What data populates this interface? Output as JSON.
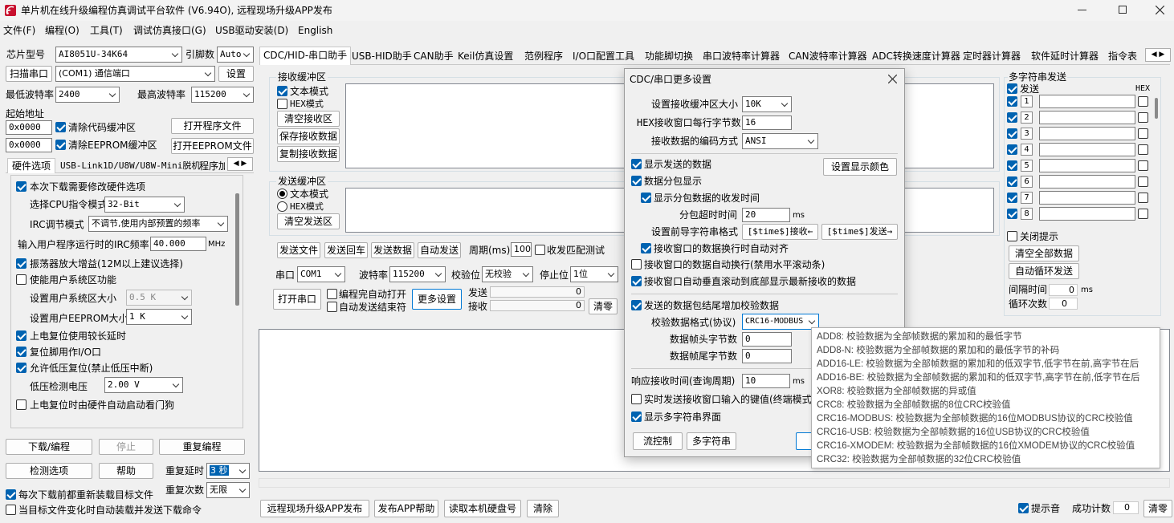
{
  "app": {
    "title": "单片机在线升级编程仿真调试平台软件 (V6.94O), 远程现场升级APP发布",
    "colors": {
      "accent": "#0063b1",
      "title_icon": "#c8102e"
    }
  },
  "menu": [
    "文件(F)",
    "编程(O)",
    "工具(T)",
    "调试仿真接口(G)",
    "USB驱动安装(D)",
    "English"
  ],
  "left": {
    "chip_label": "芯片型号",
    "chip_value": "AI8051U-34K64",
    "pins_label": "引脚数",
    "pins_value": "Auto",
    "scan_btn": "扫描串口",
    "port_value": "(COM1) 通信端口",
    "settings_btn": "设置",
    "min_baud_label": "最低波特率",
    "min_baud_value": "2400",
    "max_baud_label": "最高波特率",
    "max_baud_value": "115200",
    "start_addr_label": "起始地址",
    "addr1": "0x0000",
    "clear_code": "清除代码缓冲区",
    "open_prog": "打开程序文件",
    "addr2": "0x0000",
    "clear_eeprom": "清除EEPROM缓冲区",
    "open_eeprom": "打开EEPROM文件",
    "tabs": [
      "硬件选项",
      "USB-Link1D/U8W/U8W-Mini脱机",
      "程序加"
    ],
    "hw": {
      "need_modify": "本次下载需要修改硬件选项",
      "cpu_mode_label": "选择CPU指令模式",
      "cpu_mode_value": "32-Bit",
      "irc_mode_label": "IRC调节模式",
      "irc_mode_value": "不调节,使用内部预置的频率",
      "irc_freq_label": "输入用户程序运行时的IRC频率",
      "irc_freq_value": "40.000",
      "irc_freq_unit": "MHz",
      "osc_gain": "振荡器放大增益(12M以上建议选择)",
      "user_sys_area": "使能用户系统区功能",
      "sys_area_label": "设置用户系统区大小",
      "sys_area_value": "0.5 K",
      "eeprom_label": "设置用户EEPROM大小",
      "eeprom_value": "1   K",
      "long_delay": "上电复位使用较长延时",
      "reset_io": "复位脚用作I/O口",
      "low_volt_reset": "允许低压复位(禁止低压中断)",
      "low_volt_label": "低压检测电压",
      "low_volt_value": "2.00 V",
      "watchdog": "上电复位时由硬件自动启动看门狗"
    },
    "download_btn": "下载/编程",
    "stop_btn": "停止",
    "reprogram_btn": "重复编程",
    "detect_btn": "检测选项",
    "help_btn": "帮助",
    "repeat_delay_label": "重复延时",
    "repeat_delay_value": "3 秒",
    "repeat_count_label": "重复次数",
    "repeat_count_value": "无限",
    "reload_each": "每次下载前都重新装载目标文件",
    "auto_load": "当目标文件变化时自动装载并发送下载命令"
  },
  "main_tabs": [
    "CDC/HID-串口助手",
    "USB-HID助手",
    "CAN助手",
    "Keil仿真设置",
    "范例程序",
    "I/O口配置工具",
    "功能脚切换",
    "串口波特率计算器",
    "CAN波特率计算器",
    "ADC转换速度计算器",
    "定时器计算器",
    "软件延时计算器",
    "指令表"
  ],
  "serial": {
    "recv_title": "接收缓冲区",
    "text_mode": "文本模式",
    "hex_mode": "HEX模式",
    "clear_recv": "清空接收区",
    "save_recv": "保存接收数据",
    "copy_recv": "复制接收数据",
    "send_title": "发送缓冲区",
    "clear_send": "清空发送区",
    "send_file": "发送文件",
    "send_enter": "发送回车",
    "send_data": "发送数据",
    "auto_send": "自动发送",
    "period_label": "周期(ms)",
    "period_value": "100",
    "match_label": "收发匹配测试",
    "port_label": "串口",
    "port_value": "COM1",
    "baud_label": "波特率",
    "baud_value": "115200",
    "parity_label": "校验位",
    "parity_value": "无校验",
    "stop_label": "停止位",
    "stop_value": "1位",
    "open_port": "打开串口",
    "auto_open": "编程完自动打开",
    "auto_close": "自动发送结束符",
    "more_settings": "更多设置",
    "send_count_label": "发送",
    "send_count": "0",
    "recv_count_label": "接收",
    "recv_count": "0",
    "clear_count": "清零"
  },
  "multi": {
    "title": "多字符串发送",
    "send_col": "发送",
    "hex_col": "HEX",
    "rows": [
      "1",
      "2",
      "3",
      "4",
      "5",
      "6",
      "7",
      "8"
    ],
    "close_hint": "关闭提示",
    "clear_all": "清空全部数据",
    "auto_loop": "自动循环发送",
    "interval_label": "间隔时间",
    "interval_value": "0",
    "interval_unit": "ms",
    "loop_count_label": "循环次数",
    "loop_count_value": "0"
  },
  "dialog": {
    "title": "CDC/串口更多设置",
    "buf_size_label": "设置接收缓冲区大小",
    "buf_size_value": "10K",
    "hex_bytes_label": "HEX接收窗口每行字节数",
    "hex_bytes_value": "16",
    "encoding_label": "接收数据的编码方式",
    "encoding_value": "ANSI",
    "show_sent": "显示发送的数据",
    "set_color": "设置显示颜色",
    "packet_show": "数据分包显示",
    "packet_time": "显示分包数据的收发时间",
    "timeout_label": "分包超时时间",
    "timeout_value": "20",
    "timeout_unit": "ms",
    "prefix_label": "设置前导字符串格式",
    "prefix_recv": "[$time$]接收←",
    "prefix_send": "[$time$]发送→",
    "align": "接收窗口的数据换行时自动对齐",
    "auto_wrap": "接收窗口的数据自动换行(禁用水平滚动条)",
    "auto_scroll": "接收窗口自动垂直滚动到底部显示最新接收的数据",
    "add_check": "发送的数据包结尾增加校验数据",
    "check_fmt_label": "校验数据格式(协议)",
    "check_fmt_value": "CRC16-MODBUS",
    "head_bytes_label": "数据帧头字节数",
    "head_bytes_value": "0",
    "tail_bytes_label": "数据帧尾字节数",
    "tail_bytes_value": "0",
    "resp_time_label": "响应接收时间(查询周期)",
    "resp_time_value": "10",
    "resp_time_unit": "ms",
    "realtime_send": "实时发送接收窗口输入的键值(终端模式)",
    "show_multi": "显示多字符串界面",
    "flow_ctrl": "流控制",
    "multi_str": "多字符串"
  },
  "tooltip": [
    "ADD8: 校验数据为全部帧数据的累加和的最低字节",
    "ADD8-N: 校验数据为全部帧数据的累加和的最低字节的补码",
    "ADD16-LE: 校验数据为全部帧数据的累加和的低双字节,低字节在前,高字节在后",
    "ADD16-BE: 校验数据为全部帧数据的累加和的低双字节,高字节在前,低字节在后",
    "XOR8: 校验数据为全部帧数据的异或值",
    "CRC8: 校验数据为全部帧数据的8位CRC校验值",
    "CRC16-MODBUS: 校验数据为全部帧数据的16位MODBUS协议的CRC校验值",
    "CRC16-USB: 校验数据为全部帧数据的16位USB协议的CRC校验值",
    "CRC16-XMODEM: 校验数据为全部帧数据的16位XMODEM协议的CRC校验值",
    "CRC32: 校验数据为全部帧数据的32位CRC校验值"
  ],
  "bottom": {
    "remote_publish": "远程现场升级APP发布",
    "publish_help": "发布APP帮助",
    "read_disk": "读取本机硬盘号",
    "clear": "清除",
    "beep": "提示音",
    "success_label": "成功计数",
    "success_value": "0",
    "clear_count": "清零"
  }
}
